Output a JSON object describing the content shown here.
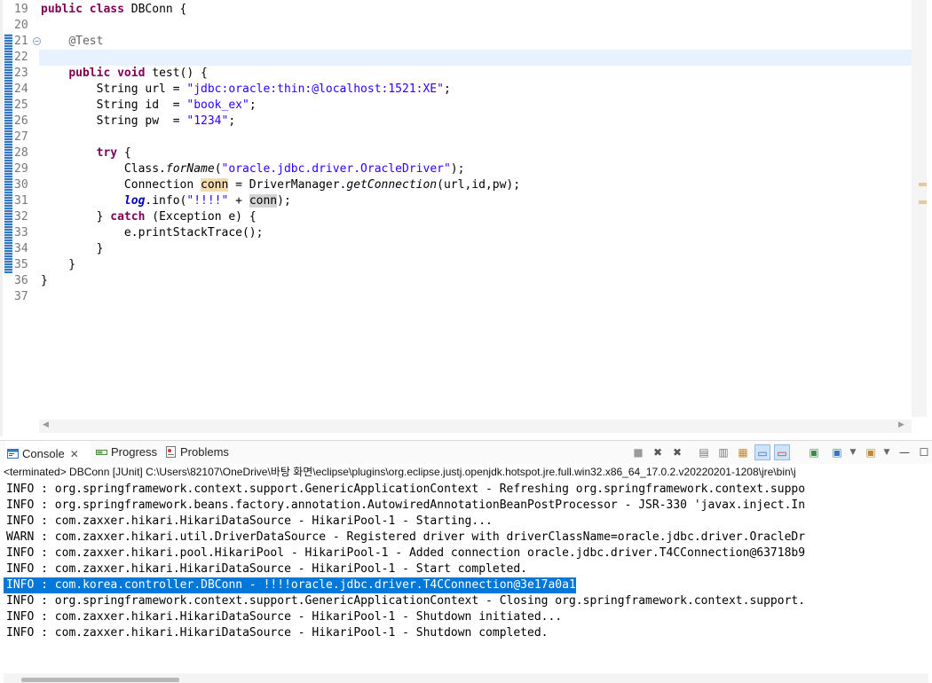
{
  "editor": {
    "lines": [
      {
        "num": "19",
        "code": [
          {
            "k": "kw",
            "t": "public"
          },
          {
            "k": "",
            "t": " "
          },
          {
            "k": "kw",
            "t": "class"
          },
          {
            "k": "",
            "t": " DBConn {"
          }
        ]
      },
      {
        "num": "20",
        "code": []
      },
      {
        "num": "21",
        "fold": true,
        "code": [
          {
            "k": "",
            "t": "    "
          },
          {
            "k": "an",
            "t": "@Test"
          }
        ]
      },
      {
        "num": "22",
        "current": true,
        "code": []
      },
      {
        "num": "23",
        "code": [
          {
            "k": "",
            "t": "    "
          },
          {
            "k": "kw",
            "t": "public"
          },
          {
            "k": "",
            "t": " "
          },
          {
            "k": "kw",
            "t": "void"
          },
          {
            "k": "",
            "t": " test() {"
          }
        ]
      },
      {
        "num": "24",
        "code": [
          {
            "k": "",
            "t": "        String url = "
          },
          {
            "k": "st",
            "t": "\"jdbc:oracle:thin:@localhost:1521:XE\""
          },
          {
            "k": "",
            "t": ";"
          }
        ]
      },
      {
        "num": "25",
        "code": [
          {
            "k": "",
            "t": "        String id  = "
          },
          {
            "k": "st",
            "t": "\"book_ex\""
          },
          {
            "k": "",
            "t": ";"
          }
        ]
      },
      {
        "num": "26",
        "code": [
          {
            "k": "",
            "t": "        String pw  = "
          },
          {
            "k": "st",
            "t": "\"1234\""
          },
          {
            "k": "",
            "t": ";"
          }
        ]
      },
      {
        "num": "27",
        "code": []
      },
      {
        "num": "28",
        "code": [
          {
            "k": "",
            "t": "        "
          },
          {
            "k": "kw",
            "t": "try"
          },
          {
            "k": "",
            "t": " {"
          }
        ]
      },
      {
        "num": "29",
        "code": [
          {
            "k": "",
            "t": "            Class."
          },
          {
            "k": "it",
            "t": "forName"
          },
          {
            "k": "",
            "t": "("
          },
          {
            "k": "st",
            "t": "\"oracle.jdbc.driver.OracleDriver\""
          },
          {
            "k": "",
            "t": ");"
          }
        ]
      },
      {
        "num": "30",
        "code": [
          {
            "k": "",
            "t": "            Connection "
          },
          {
            "k": "occ-w",
            "t": "conn"
          },
          {
            "k": "",
            "t": " = DriverManager."
          },
          {
            "k": "it",
            "t": "getConnection"
          },
          {
            "k": "",
            "t": "(url,id,pw);"
          }
        ]
      },
      {
        "num": "31",
        "code": [
          {
            "k": "",
            "t": "            "
          },
          {
            "k": "fl",
            "t": "log"
          },
          {
            "k": "",
            "t": ".info("
          },
          {
            "k": "st",
            "t": "\"!!!!\""
          },
          {
            "k": "",
            "t": " + "
          },
          {
            "k": "occ-r",
            "t": "conn"
          },
          {
            "k": "",
            "t": ");"
          }
        ]
      },
      {
        "num": "32",
        "code": [
          {
            "k": "",
            "t": "        } "
          },
          {
            "k": "kw",
            "t": "catch"
          },
          {
            "k": "",
            "t": " (Exception e) {"
          }
        ]
      },
      {
        "num": "33",
        "code": [
          {
            "k": "",
            "t": "            e.printStackTrace();"
          }
        ]
      },
      {
        "num": "34",
        "code": [
          {
            "k": "",
            "t": "        }"
          }
        ]
      },
      {
        "num": "35",
        "code": [
          {
            "k": "",
            "t": "    }"
          }
        ]
      },
      {
        "num": "36",
        "code": [
          {
            "k": "",
            "t": "}"
          }
        ]
      },
      {
        "num": "37",
        "code": []
      }
    ]
  },
  "console": {
    "tabs": [
      {
        "label": "Console",
        "icon": "console-icon",
        "active": true,
        "closable": true
      },
      {
        "label": "Progress",
        "icon": "progress-icon",
        "active": false
      },
      {
        "label": "Problems",
        "icon": "problems-icon",
        "active": false
      }
    ],
    "toolbar_icons": [
      "terminate-icon",
      "remove-launch-icon",
      "remove-all-terminated-icon",
      "clear-console-icon",
      "scroll-lock-icon",
      "word-wrap-icon",
      "show-on-stdout-icon",
      "show-on-stderr-icon",
      "pin-console-icon",
      "display-console-icon",
      "open-console-icon",
      "minimize-icon",
      "maximize-icon"
    ],
    "description": "<terminated> DBConn [JUnit] C:\\Users\\82107\\OneDrive\\바탕 화면\\eclipse\\plugins\\org.eclipse.justj.openjdk.hotspot.jre.full.win32.x86_64_17.0.2.v20220201-1208\\jre\\bin\\j",
    "lines": [
      "INFO : org.springframework.context.support.GenericApplicationContext - Refreshing org.springframework.context.suppo",
      "INFO : org.springframework.beans.factory.annotation.AutowiredAnnotationBeanPostProcessor - JSR-330 'javax.inject.In",
      "INFO : com.zaxxer.hikari.HikariDataSource - HikariPool-1 - Starting...",
      "WARN : com.zaxxer.hikari.util.DriverDataSource - Registered driver with driverClassName=oracle.jdbc.driver.OracleDr",
      "INFO : com.zaxxer.hikari.pool.HikariPool - HikariPool-1 - Added connection oracle.jdbc.driver.T4CConnection@63718b9",
      "INFO : com.zaxxer.hikari.HikariDataSource - HikariPool-1 - Start completed.",
      "INFO : com.korea.controller.DBConn - !!!!oracle.jdbc.driver.T4CConnection@3e17a0a1",
      "INFO : org.springframework.context.support.GenericApplicationContext - Closing org.springframework.context.support.",
      "INFO : com.zaxxer.hikari.HikariDataSource - HikariPool-1 - Shutdown initiated...",
      "INFO : com.zaxxer.hikari.HikariDataSource - HikariPool-1 - Shutdown completed."
    ],
    "selected_line": 6
  }
}
